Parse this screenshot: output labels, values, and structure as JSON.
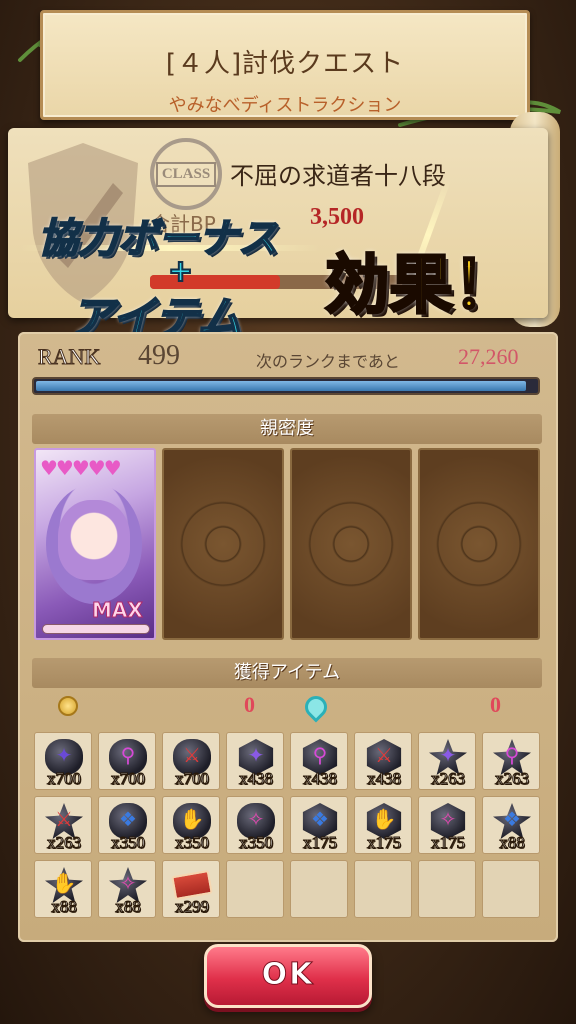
{
  "quest": {
    "title": "[４人]討伐クエスト",
    "subtitle": "やみなべディストラクション"
  },
  "class_panel": {
    "stamp_label": "CLASS",
    "class_name": "不屈の求道者十八段",
    "bp_label": "合計BP",
    "bp_value": "3,500",
    "bp_fill": 0.5
  },
  "promo": {
    "line1": "協力ボーナス",
    "plus": "+",
    "line2": "アイテム",
    "line3": "効果！"
  },
  "rank": {
    "label": "RANK",
    "value": "499",
    "next_label": "次のランクまであと",
    "next_value": "27,260",
    "exp_fill": 0.98
  },
  "intimacy": {
    "header": "親密度",
    "card": {
      "hearts": "♥♥♥♥♥",
      "max_label": "MAX"
    }
  },
  "items": {
    "header": "獲得アイテム",
    "coin_icon": "coin-icon",
    "coin_value": "0",
    "drop_icon": "spirit-icon",
    "drop_value": "0",
    "list": [
      {
        "shape": "round",
        "glyph": "✦",
        "color": "#6a4ad6",
        "qty": "x700"
      },
      {
        "shape": "round",
        "glyph": "⚲",
        "color": "#d64ad6",
        "qty": "x700"
      },
      {
        "shape": "round",
        "glyph": "⚔",
        "color": "#e03a3a",
        "qty": "x700"
      },
      {
        "shape": "hex",
        "glyph": "✦",
        "color": "#8a5ae6",
        "qty": "x438"
      },
      {
        "shape": "hex",
        "glyph": "⚲",
        "color": "#d64ad6",
        "qty": "x438"
      },
      {
        "shape": "hex",
        "glyph": "⚔",
        "color": "#e03a3a",
        "qty": "x438"
      },
      {
        "shape": "star",
        "glyph": "✦",
        "color": "#8a5ae6",
        "qty": "x263"
      },
      {
        "shape": "star",
        "glyph": "⚲",
        "color": "#d64ad6",
        "qty": "x263"
      },
      {
        "shape": "star",
        "glyph": "⚔",
        "color": "#e03a3a",
        "qty": "x263"
      },
      {
        "shape": "round",
        "glyph": "❖",
        "color": "#3a7ae0",
        "qty": "x350"
      },
      {
        "shape": "round",
        "glyph": "✋",
        "color": "#f0d020",
        "qty": "x350"
      },
      {
        "shape": "round",
        "glyph": "✧",
        "color": "#e04ab0",
        "qty": "x350"
      },
      {
        "shape": "hex",
        "glyph": "❖",
        "color": "#3a7ae0",
        "qty": "x175"
      },
      {
        "shape": "hex",
        "glyph": "✋",
        "color": "#f0d020",
        "qty": "x175"
      },
      {
        "shape": "hex",
        "glyph": "✧",
        "color": "#e04ab0",
        "qty": "x175"
      },
      {
        "shape": "star",
        "glyph": "❖",
        "color": "#3a7ae0",
        "qty": "x88"
      },
      {
        "shape": "star",
        "glyph": "✋",
        "color": "#f0d020",
        "qty": "x88"
      },
      {
        "shape": "star",
        "glyph": "✧",
        "color": "#e04ab0",
        "qty": "x88"
      },
      {
        "shape": "ticket",
        "glyph": "",
        "color": "#d84a3a",
        "qty": "x299"
      }
    ],
    "total_slots": 24
  },
  "ok_button": "OK"
}
